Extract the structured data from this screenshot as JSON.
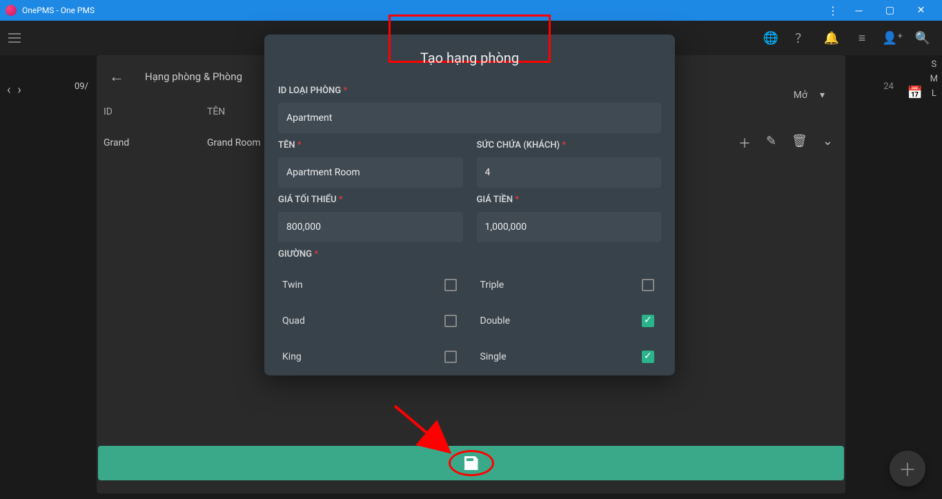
{
  "app": {
    "title": "OnePMS - One PMS"
  },
  "panel": {
    "title": "Hạng phòng & Phòng",
    "col_id": "ID",
    "col_name": "TÊN",
    "select_label": "Mở",
    "row": {
      "id": "Grand",
      "name": "Grand Room"
    }
  },
  "nav": {
    "date_hint": "09/",
    "right_date_hint": "24"
  },
  "sizes": [
    "S",
    "M",
    "L"
  ],
  "modal": {
    "title": "Tạo hạng phòng",
    "labels": {
      "roomtype_id": "ID LOẠI PHÒNG",
      "name": "TÊN",
      "capacity": "SỨC CHỨA (KHÁCH)",
      "min_price": "GIÁ TỐI THIỂU",
      "price": "GIÁ TIỀN",
      "bed": "GIƯỜNG"
    },
    "values": {
      "roomtype_id": "Apartment",
      "name": "Apartment Room",
      "capacity": "4",
      "min_price": "800,000",
      "price": "1,000,000"
    },
    "beds": [
      {
        "label": "Twin",
        "checked": false
      },
      {
        "label": "Triple",
        "checked": false
      },
      {
        "label": "Quad",
        "checked": false
      },
      {
        "label": "Double",
        "checked": true
      },
      {
        "label": "King",
        "checked": false
      },
      {
        "label": "Single",
        "checked": true
      }
    ]
  }
}
